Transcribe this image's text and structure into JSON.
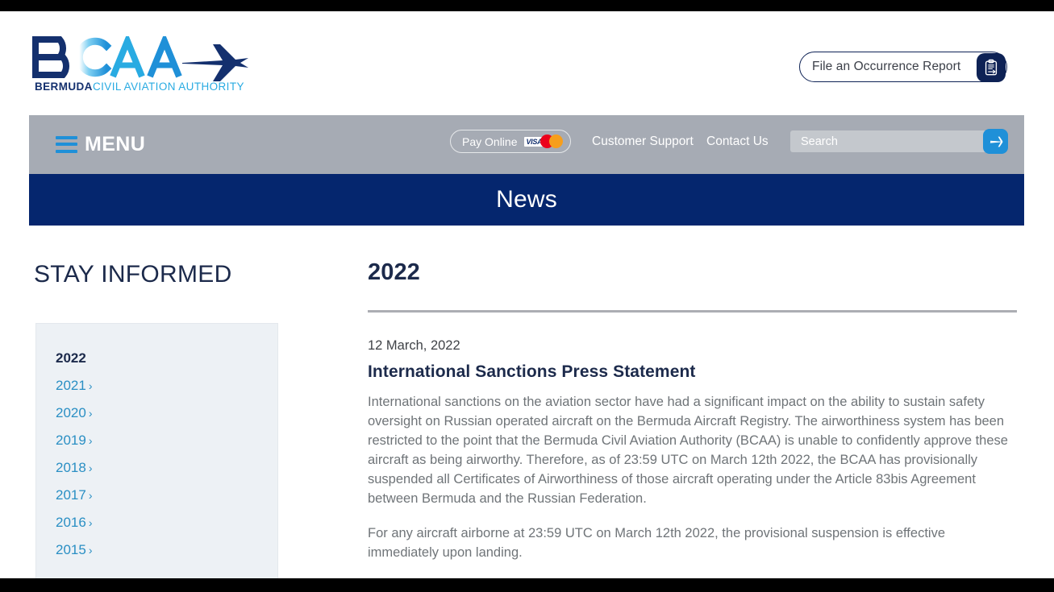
{
  "header": {
    "logo": {
      "mark_text": "BCAA",
      "tagline_bold": "BERMUDA",
      "tagline_light": "CIVIL AVIATION AUTHORITY",
      "colors": {
        "navy": "#14306e",
        "blue": "#1f90d8",
        "cyan": "#29abe2"
      }
    },
    "occurrence_button": {
      "label": "File an Occurrence Report",
      "icon": "clipboard-arrow-icon",
      "icon_bg": "#0e2255"
    }
  },
  "nav": {
    "menu_label": "MENU",
    "menu_icon": "hamburger-icon",
    "menu_icon_color": "#1f90d8",
    "pay_online": {
      "label": "Pay Online",
      "cards": [
        "visa-logo",
        "mastercard-logo"
      ],
      "visa_text": "VISA",
      "mastercard_colors": {
        "left": "#eb001b",
        "right": "#f79e1b"
      }
    },
    "links": [
      {
        "label": "Customer Support",
        "name": "nav-link-customer-support"
      },
      {
        "label": "Contact Us",
        "name": "nav-link-contact-us"
      }
    ],
    "search": {
      "placeholder": "Search",
      "value": "",
      "button_icon": "airplane-icon",
      "button_color": "#1f90d8"
    },
    "bar_color": "#a6abb4"
  },
  "banner": {
    "title": "News",
    "background": "#05266e"
  },
  "sidebar": {
    "heading": "STAY INFORMED",
    "panel_background": "#edf1f5",
    "years": [
      {
        "label": "2022",
        "chevron": "",
        "active": true
      },
      {
        "label": "2021",
        "chevron": "›",
        "active": false
      },
      {
        "label": "2020",
        "chevron": "›",
        "active": false
      },
      {
        "label": "2019",
        "chevron": "›",
        "active": false
      },
      {
        "label": "2018",
        "chevron": "›",
        "active": false
      },
      {
        "label": "2017",
        "chevron": "›",
        "active": false
      },
      {
        "label": "2016",
        "chevron": "›",
        "active": false
      },
      {
        "label": "2015",
        "chevron": "›",
        "active": false
      }
    ],
    "link_color": "#2a8fc4"
  },
  "content": {
    "year_heading": "2022",
    "article": {
      "date": "12 March, 2022",
      "title": "International Sanctions Press Statement",
      "paragraph_1": "International sanctions on the aviation sector have had a significant impact on the ability to sustain safety oversight on Russian operated aircraft on the Bermuda Aircraft Registry. The airworthiness system has been restricted to the point that the Bermuda Civil Aviation Authority (BCAA) is unable to confidently approve these aircraft as being airworthy. Therefore, as of 23:59 UTC on March 12th 2022, the BCAA has provisionally suspended all Certificates of Airworthiness of those aircraft operating under the Article 83bis Agreement between Bermuda and the Russian Federation.",
      "paragraph_2": "For any aircraft airborne at 23:59 UTC on March 12th 2022, the provisional suspension is effective immediately upon landing."
    }
  }
}
